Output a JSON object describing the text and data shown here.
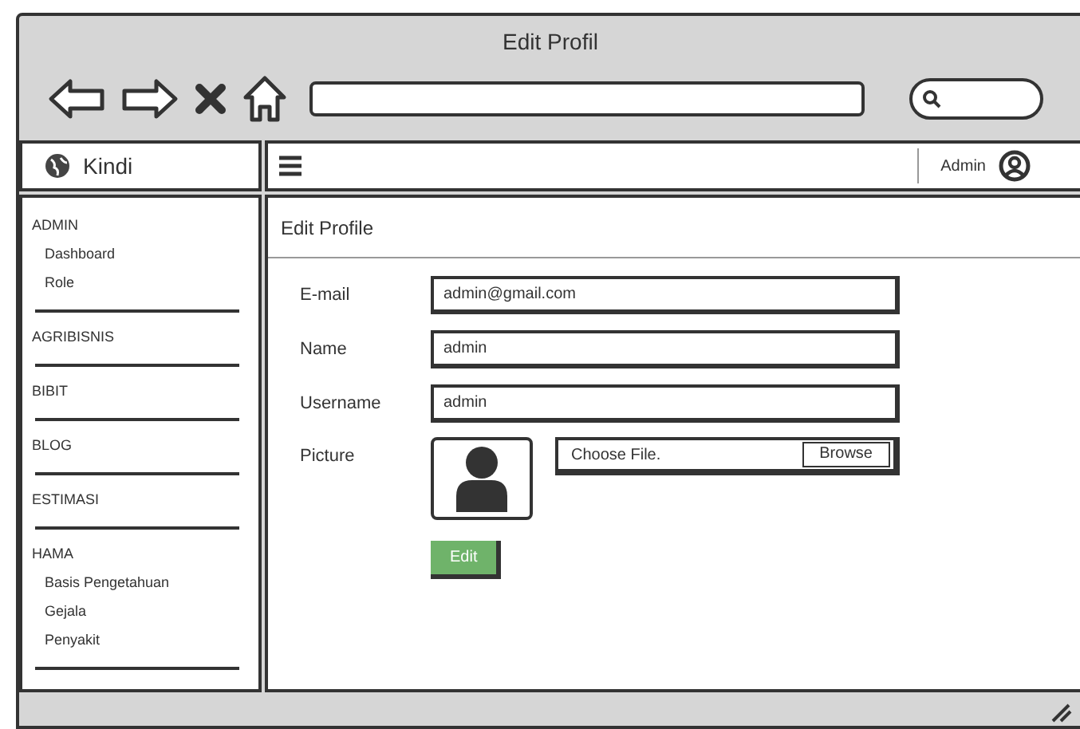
{
  "window": {
    "title": "Edit Profil"
  },
  "brand": {
    "label": "Kindi"
  },
  "topbar": {
    "user": "Admin"
  },
  "sidebar": {
    "sections": [
      {
        "label": "ADMIN",
        "items": [
          "Dashboard",
          "Role"
        ]
      },
      {
        "label": "AGRIBISNIS"
      },
      {
        "label": "BIBIT"
      },
      {
        "label": "BLOG"
      },
      {
        "label": "ESTIMASI"
      },
      {
        "label": "HAMA",
        "items": [
          "Basis Pengetahuan",
          "Gejala",
          "Penyakit"
        ]
      }
    ]
  },
  "content": {
    "heading": "Edit Profile",
    "fields": [
      {
        "kind": "text",
        "label": "E-mail",
        "value": "admin@gmail.com"
      },
      {
        "kind": "text",
        "label": "Name",
        "value": "admin"
      },
      {
        "kind": "text",
        "label": "Username",
        "value": "admin"
      },
      {
        "kind": "picture",
        "label": "Picture",
        "placeholder": "Choose File.",
        "button": "Browse"
      }
    ],
    "submit": "Edit"
  }
}
